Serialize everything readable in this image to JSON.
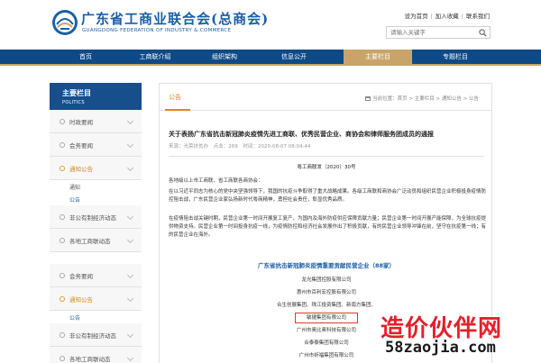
{
  "header": {
    "org_name_cn": "广东省工商业联合会(总商会)",
    "org_name_en": "GUANGDONG FEDERATION OF INDUSTRY & COMMERCE",
    "links": [
      "设为首页",
      "加入收藏",
      "联系我们"
    ],
    "search_placeholder": "请输入关键字"
  },
  "nav": {
    "items": [
      "首页",
      "工商联介绍",
      "组织架构",
      "信息公开",
      "主要栏目",
      "专题栏目"
    ],
    "active": "主要栏目"
  },
  "sidebar": {
    "title": "主要栏目",
    "subtitle": "POLITICS",
    "items": [
      {
        "label": "时政要闻"
      },
      {
        "label": "会务要闻"
      },
      {
        "label": "通知公告"
      },
      {
        "label": "通知"
      },
      {
        "label": "公告"
      },
      {
        "label": "非公有制经济动态"
      },
      {
        "label": "各地工商联动态"
      },
      {
        "label": "会务要闻"
      },
      {
        "label": "通知公告"
      },
      {
        "label": "公告"
      },
      {
        "label": "非公有制经济动态"
      },
      {
        "label": "各地工商联动态"
      }
    ]
  },
  "main": {
    "tab": "公告",
    "breadcrumb": "当前位置：首页 > 主要栏目 > 通知公告 > 公告",
    "article_title": "关于表扬广东省抗击新冠肺炎疫情先进工商联、优秀民营企业、商协会和律师服务团成员的通报",
    "meta_source": "来源：光荣扶贫办",
    "meta_views": "点击：269",
    "meta_time": "时间：2020-08-07 08:04:44",
    "doc_number": "粤工商联发〔2020〕30号",
    "greeting": "各地级以上市工商联、省工商联各商协会：",
    "paragraph1": "在以习近平同志为核心的党中央坚强领导下，我国的抗疫斗争取得了重大战略成果。各级工商联和商协会广泛动员和组织民营企业积极投身疫情防控阻击战，广东民营企业家弘扬新时代粤商精神，勇担社会责任，彰显优秀品质。",
    "paragraph2": "在疫情阻击战关键时期，民营企业第一时间开展复工复产，为国内及海外防疫供应保障贡献力量；民营企业第一时间开展产能保障，为全球抗疫提供物资支持。民营企业第一时间投身抗疫一线，为疫情防控和经济社会发展作出了积极贡献，有的民营企业领导冲锋在前，坚守在抗疫第一线；有的民营企业在海外。",
    "honor_title": "广东省抗击新冠肺炎疫情重要贡献民营企业（88家）",
    "honor_list": [
      "龙光集团控股有限公司",
      "惠州市百利宏控股有限公司",
      "合生创展集团、珠江投资集团、新南方集团、",
      "敏捷集团有限公司",
      "广州市奥比奥科技有限公司",
      "合泰泰集团有限公司",
      "广州市祈福集团有限公司"
    ],
    "highlighted_index": 3
  },
  "watermark": {
    "cn": "造价伙伴网",
    "url": "58zaojia.com"
  },
  "colors": {
    "nav_bg": "#0e4a86",
    "accent_gold": "#c9a46a",
    "brand_blue": "#1b5fa6",
    "active_orange": "#d38a1e",
    "highlight_red": "#e23a2a"
  }
}
